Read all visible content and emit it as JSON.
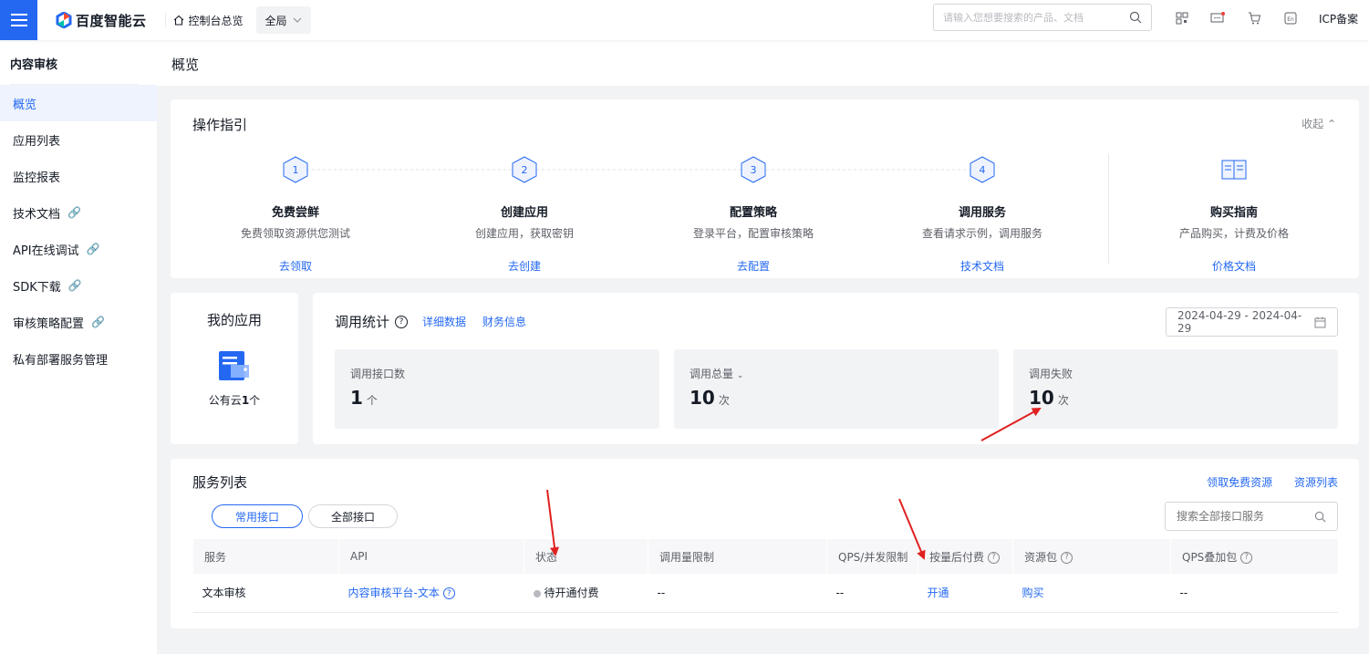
{
  "topbar": {
    "brand": "百度智能云",
    "console_label": "控制台总览",
    "region": "全局",
    "search_placeholder": "请输入您想要搜索的产品、文档",
    "icp_label": "ICP备案"
  },
  "sidebar": {
    "title": "内容审核",
    "items": [
      {
        "label": "概览"
      },
      {
        "label": "应用列表"
      },
      {
        "label": "监控报表"
      },
      {
        "label": "技术文档"
      },
      {
        "label": "API在线调试"
      },
      {
        "label": "SDK下载"
      },
      {
        "label": "审核策略配置"
      },
      {
        "label": "私有部署服务管理"
      }
    ]
  },
  "page": {
    "title": "概览"
  },
  "guide": {
    "title": "操作指引",
    "collapse_label": "收起",
    "steps": [
      {
        "num": "1",
        "name": "免费尝鲜",
        "desc": "免费领取资源供您测试",
        "link": "去领取"
      },
      {
        "num": "2",
        "name": "创建应用",
        "desc": "创建应用，获取密钥",
        "link": "去创建"
      },
      {
        "num": "3",
        "name": "配置策略",
        "desc": "登录平台，配置审核策略",
        "link": "去配置"
      },
      {
        "num": "4",
        "name": "调用服务",
        "desc": "查看请求示例，调用服务",
        "link": "技术文档"
      }
    ],
    "purchase": {
      "name": "购买指南",
      "desc": "产品购买，计费及价格",
      "link": "价格文档"
    }
  },
  "my_apps": {
    "title": "我的应用",
    "label": "公有云",
    "count": "1",
    "unit": "个"
  },
  "stats": {
    "title": "调用统计",
    "link_detail": "详细数据",
    "link_finance": "财务信息",
    "date_range": "2024-04-29 - 2024-04-29",
    "boxes": [
      {
        "label": "调用接口数",
        "value": "1",
        "unit": "个"
      },
      {
        "label": "调用总量",
        "value": "10",
        "unit": "次"
      },
      {
        "label": "调用失败",
        "value": "10",
        "unit": "次"
      }
    ]
  },
  "services": {
    "title": "服务列表",
    "link_free": "领取免费资源",
    "link_resources": "资源列表",
    "tab_common": "常用接口",
    "tab_all": "全部接口",
    "search_placeholder": "搜索全部接口服务",
    "columns": [
      "服务",
      "API",
      "状态",
      "调用量限制",
      "QPS/并发限制",
      "按量后付费",
      "资源包",
      "QPS叠加包"
    ],
    "rows": [
      {
        "service": "文本审核",
        "api": "内容审核平台-文本",
        "status": "待开通付费",
        "call_limit": "--",
        "qps_limit": "--",
        "postpaid": "开通",
        "package": "购买",
        "qps_package": "--"
      }
    ]
  },
  "colors": {
    "accent": "#2468f2",
    "annotation": "#e02020"
  }
}
